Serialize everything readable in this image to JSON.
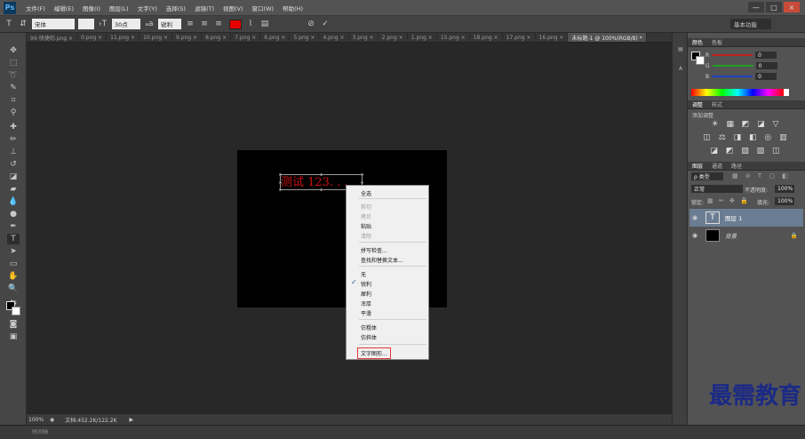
{
  "menubar": {
    "logo": "Ps",
    "items": [
      "文件(F)",
      "编辑(E)",
      "图像(I)",
      "图层(L)",
      "文字(Y)",
      "选择(S)",
      "滤镜(T)",
      "视图(V)",
      "窗口(W)",
      "帮助(H)"
    ],
    "window_controls": [
      "—",
      "□",
      "×"
    ]
  },
  "options_bar": {
    "font_family": "宋体",
    "font_size": "30点",
    "anti_alias": "锐利",
    "text_color": "#e60000",
    "workspace": "基本功能"
  },
  "tabs": [
    "99-快捷的.png ×",
    "0.png ×",
    "11.png ×",
    "10.png ×",
    "9.png ×",
    "8.png ×",
    "7.png ×",
    "6.png ×",
    "5.png ×",
    "4.png ×",
    "3.png ×",
    "2.png ×",
    "1.png ×",
    "15.png ×",
    "18.png ×",
    "17.png ×",
    "16.png ×",
    "未标题-1 @ 100%(RGB/8) *"
  ],
  "document": {
    "text": "测试 123. . ."
  },
  "context_menu": {
    "items": [
      {
        "label": "全选",
        "disabled": false
      },
      {
        "label": "剪切",
        "disabled": true
      },
      {
        "label": "拷贝",
        "disabled": true
      },
      {
        "label": "粘贴",
        "disabled": false
      },
      {
        "label": "清除",
        "disabled": true
      },
      {
        "label": "拼写检查...",
        "disabled": false
      },
      {
        "label": "查找和替换文本...",
        "disabled": false
      },
      {
        "label": "无",
        "disabled": false
      },
      {
        "label": "锐利",
        "disabled": false,
        "checked": true
      },
      {
        "label": "犀利",
        "disabled": false
      },
      {
        "label": "浑厚",
        "disabled": false
      },
      {
        "label": "平滑",
        "disabled": false
      },
      {
        "label": "仿粗体",
        "disabled": false
      },
      {
        "label": "仿斜体",
        "disabled": false
      },
      {
        "label": "文字图形...",
        "disabled": false,
        "highlight": true
      }
    ]
  },
  "status_bar": {
    "zoom": "100%",
    "doc_info": "文档:452.2K/122.2K"
  },
  "timeline": {
    "label": "时间轴"
  },
  "color_panel": {
    "tabs": [
      "颜色",
      "色板"
    ],
    "channels": [
      {
        "name": "R",
        "value": "0",
        "track": "#c02020"
      },
      {
        "name": "G",
        "value": "0",
        "track": "#20a020"
      },
      {
        "name": "B",
        "value": "0",
        "track": "#2040c0"
      }
    ]
  },
  "adjustments_panel": {
    "tabs": [
      "调整",
      "样式"
    ],
    "title": "添加调整",
    "icon_rows": [
      "☀ ▦ ◩ ◪ ▽",
      "◫ ⚖ ◨ ◧ ◎ ▥",
      "◪ ◩ ▧ ▨ ◫"
    ]
  },
  "layers_panel": {
    "tabs": [
      "图层",
      "通道",
      "路径"
    ],
    "kind": "ρ 类型",
    "blend_mode": "正常",
    "opacity_label": "不透明度:",
    "opacity": "100%",
    "lock_label": "锁定:",
    "fill_label": "填充:",
    "fill": "100%",
    "layers": [
      {
        "name": "图层 1",
        "thumb": "T",
        "selected": true
      },
      {
        "name": "背景",
        "thumb": "",
        "selected": false
      }
    ]
  },
  "watermark": "最需教育"
}
